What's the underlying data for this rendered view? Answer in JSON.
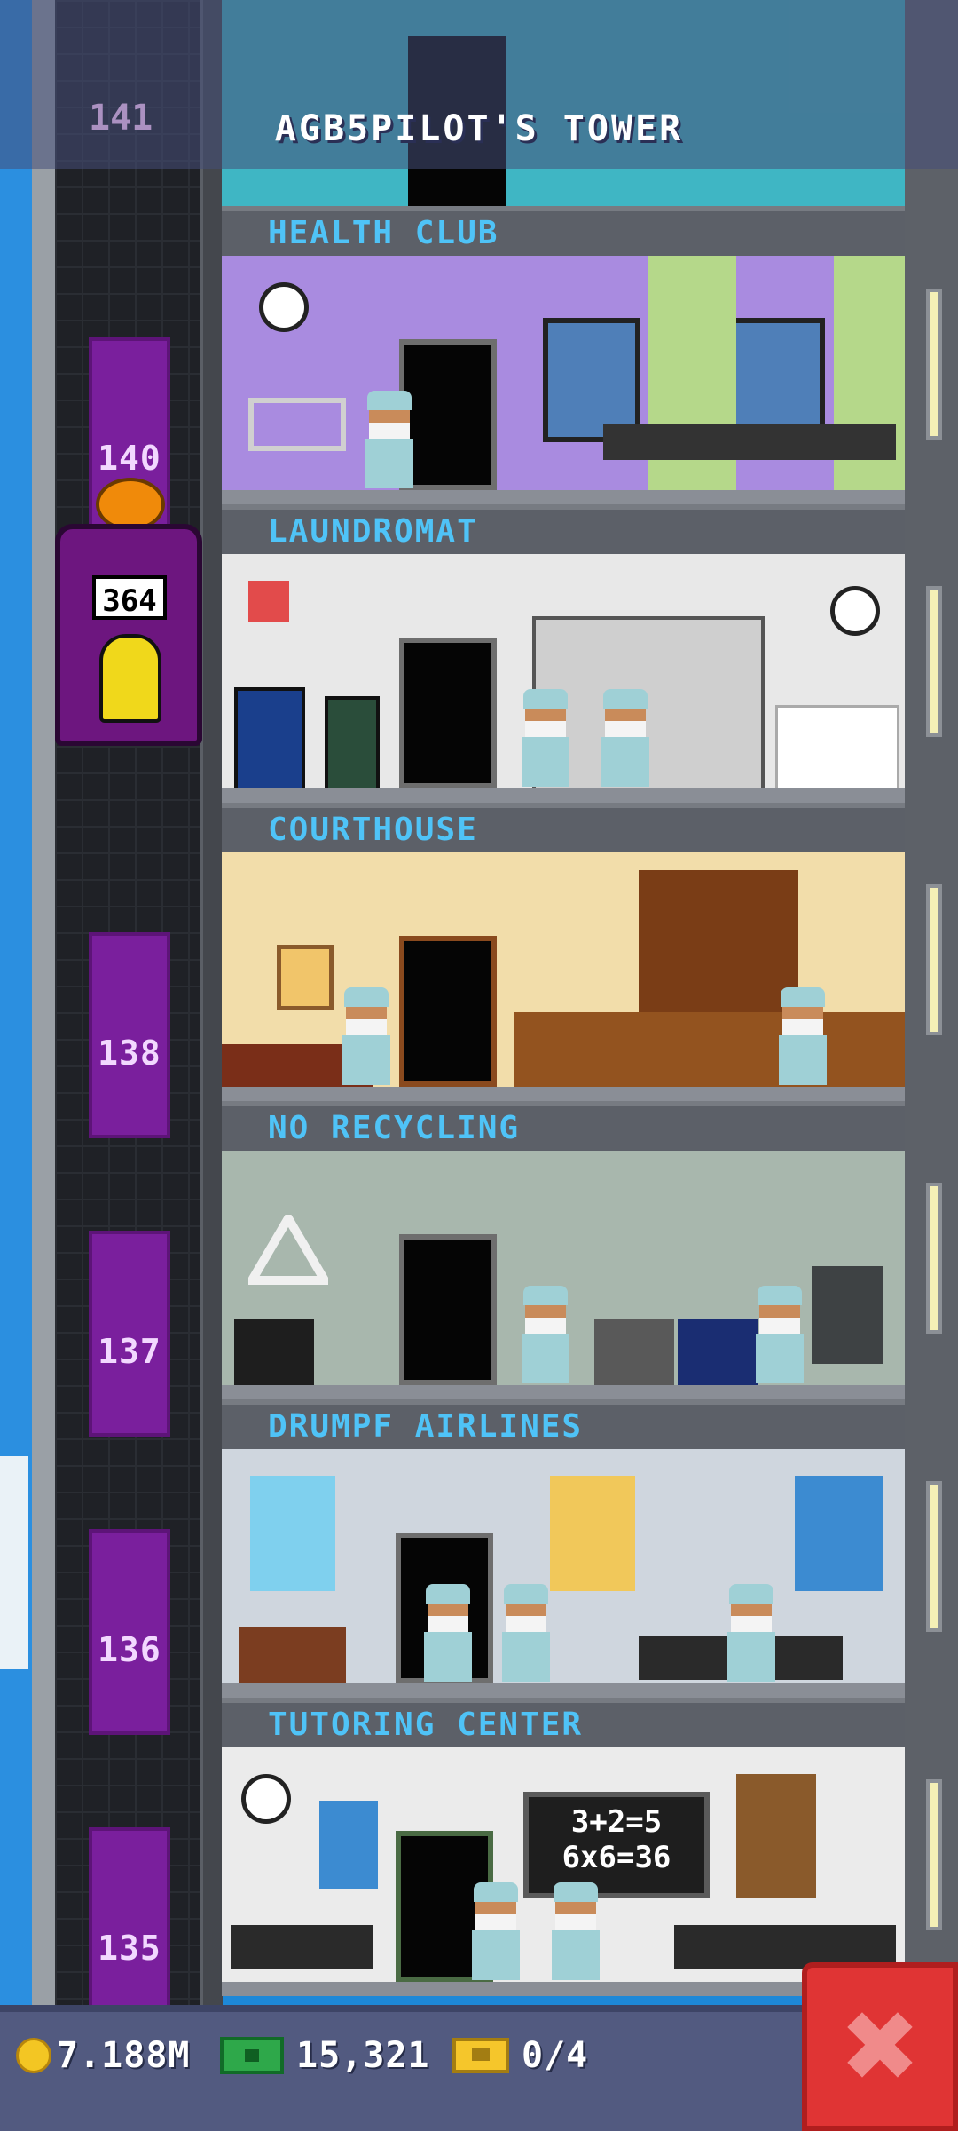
{
  "tower": {
    "title": "AGB5PILOT'S TOWER",
    "top_floor_number": "141"
  },
  "floors": [
    {
      "name": "HEALTH CLUB",
      "number": "140",
      "wall": "#a98be0"
    },
    {
      "name": "LAUNDROMAT",
      "number": "",
      "wall": "#e8e8e8"
    },
    {
      "name": "COURTHOUSE",
      "number": "138",
      "wall": "#f2ddaa"
    },
    {
      "name": "NO RECYCLING",
      "number": "137",
      "wall": "#a8b7ad"
    },
    {
      "name": "DRUMPF AIRLINES",
      "number": "136",
      "wall": "#cfd6de"
    },
    {
      "name": "TUTORING CENTER",
      "number": "135",
      "wall": "#ebebeb"
    }
  ],
  "elevator": {
    "count": "364"
  },
  "tutoring_board": {
    "line1": "3+2=5",
    "line2": "6x6=36"
  },
  "footer": {
    "coins": "7.188M",
    "bux": "15,321",
    "tickets": "0/4"
  },
  "colors": {
    "accent_sign_text": "#4fc3f7",
    "close_button": "#e03434",
    "floor_number_bg": "#7a1f9d"
  },
  "icons": {
    "close": "x-icon",
    "coin": "coin-icon",
    "cash": "cash-icon",
    "ticket": "ticket-icon"
  }
}
